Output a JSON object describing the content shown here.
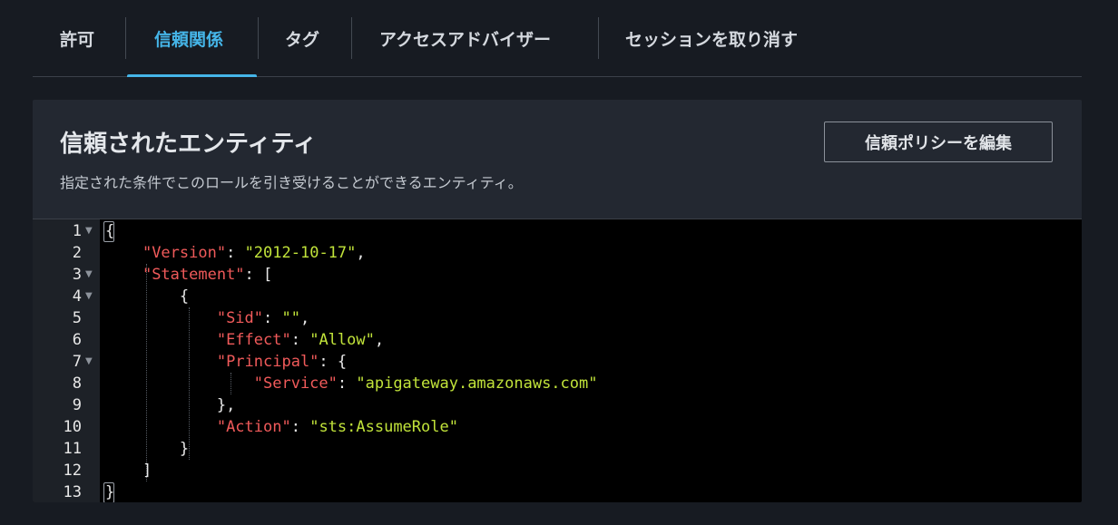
{
  "tabs": [
    {
      "label": "許可",
      "active": false
    },
    {
      "label": "信頼関係",
      "active": true
    },
    {
      "label": "タグ",
      "active": false
    },
    {
      "label": "アクセスアドバイザー",
      "active": false
    },
    {
      "label": "セッションを取り消す",
      "active": false
    }
  ],
  "panel": {
    "title": "信頼されたエンティティ",
    "description": "指定された条件でこのロールを引き受けることができるエンティティ。",
    "edit_button_label": "信頼ポリシーを編集"
  },
  "editor": {
    "line_numbers": [
      "1",
      "2",
      "3",
      "4",
      "5",
      "6",
      "7",
      "8",
      "9",
      "10",
      "11",
      "12",
      "13"
    ],
    "foldable_lines": [
      1,
      3,
      4,
      7
    ],
    "colors": {
      "key": "#f05a5a",
      "string": "#c1e33a",
      "punctuation": "#e8e8e8",
      "background": "#000000"
    },
    "tokens": {
      "l1_open": "{",
      "version_key": "\"Version\"",
      "version_value": "\"2012-10-17\"",
      "statement_key": "\"Statement\"",
      "statement_open": "[",
      "obj_open": "{",
      "sid_key": "\"Sid\"",
      "sid_value": "\"\"",
      "effect_key": "\"Effect\"",
      "effect_value": "\"Allow\"",
      "principal_key": "\"Principal\"",
      "principal_open": "{",
      "service_key": "\"Service\"",
      "service_value": "\"apigateway.amazonaws.com\"",
      "principal_close": "},",
      "action_key": "\"Action\"",
      "action_value": "\"sts:AssumeRole\"",
      "obj_close": "}",
      "statement_close": "]",
      "l13_close": "}"
    }
  }
}
